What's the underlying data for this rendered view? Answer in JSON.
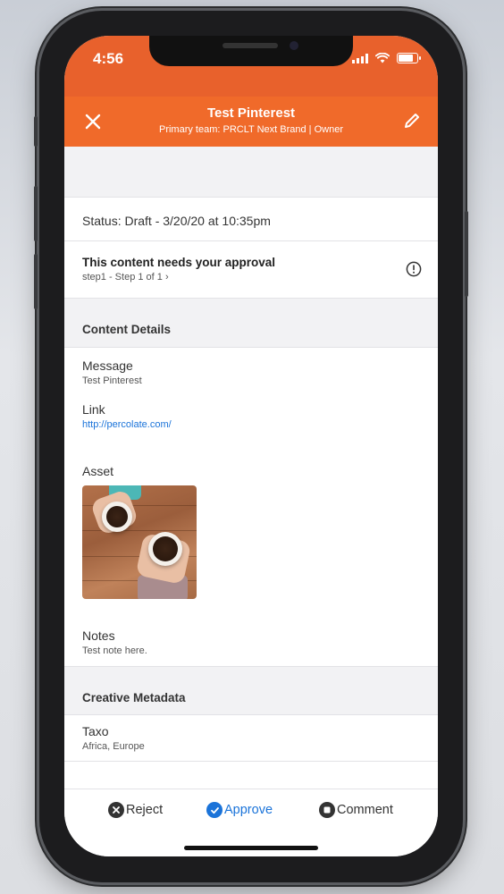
{
  "status_bar": {
    "time": "4:56"
  },
  "header": {
    "title": "Test Pinterest",
    "subtitle": "Primary team: PRCLT Next Brand | Owner",
    "close_icon": "close-icon",
    "edit_icon": "pencil-icon",
    "color": "#f06a2a"
  },
  "status": {
    "text": "Status: Draft - 3/20/20 at 10:35pm"
  },
  "approval": {
    "title": "This content needs your approval",
    "step": "step1 - Step 1 of 1 ›",
    "icon": "info-icon"
  },
  "content_details": {
    "heading": "Content Details",
    "message": {
      "label": "Message",
      "value": "Test Pinterest"
    },
    "link": {
      "label": "Link",
      "value": "http://percolate.com/"
    },
    "asset": {
      "label": "Asset",
      "image": "coffee-cups-photo"
    },
    "notes": {
      "label": "Notes",
      "value": "Test note here."
    }
  },
  "creative_metadata": {
    "heading": "Creative Metadata",
    "taxo": {
      "label": "Taxo",
      "value": "Africa, Europe"
    }
  },
  "actions": {
    "reject": "Reject",
    "approve": "Approve",
    "comment": "Comment",
    "approve_color": "#1a73d9"
  }
}
